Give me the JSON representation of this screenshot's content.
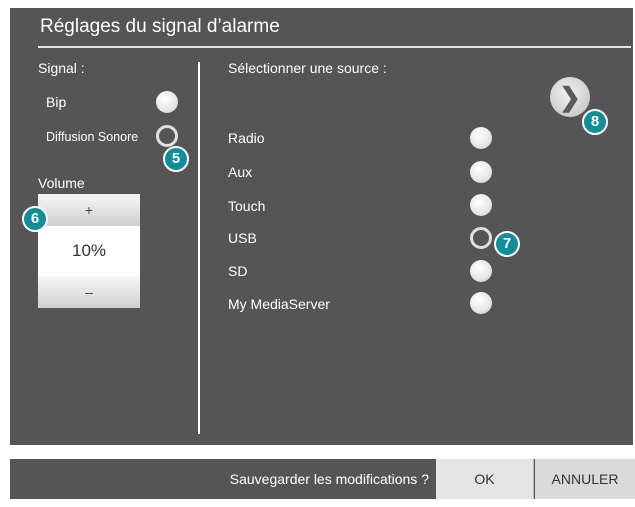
{
  "title": "Réglages du signal d’alarme",
  "signal": {
    "label": "Signal :",
    "options": [
      {
        "label": "Bip",
        "selected": false
      },
      {
        "label": "Diffusion Sonore",
        "selected": true
      }
    ]
  },
  "volume": {
    "label": "Volume",
    "plus": "+",
    "value": "10%",
    "minus": "–"
  },
  "source": {
    "label": "Sélectionner une source :",
    "items": [
      {
        "label": "Radio",
        "selected": false
      },
      {
        "label": "Aux",
        "selected": false
      },
      {
        "label": "Touch",
        "selected": false
      },
      {
        "label": "USB",
        "selected": true
      },
      {
        "label": "SD",
        "selected": false
      },
      {
        "label": "My MediaServer",
        "selected": false
      }
    ]
  },
  "next_button": {
    "icon": "chevron-right-icon",
    "glyph": "❯"
  },
  "callouts": {
    "signal_option": "5",
    "volume": "6",
    "source_item": "7",
    "next": "8"
  },
  "footer": {
    "question": "Sauvegarder les modifications ?",
    "ok_label": "OK",
    "cancel_label": "ANNULER"
  },
  "colors": {
    "panel": "#555555",
    "accent": "#0e8e9a",
    "text": "#ffffff"
  }
}
